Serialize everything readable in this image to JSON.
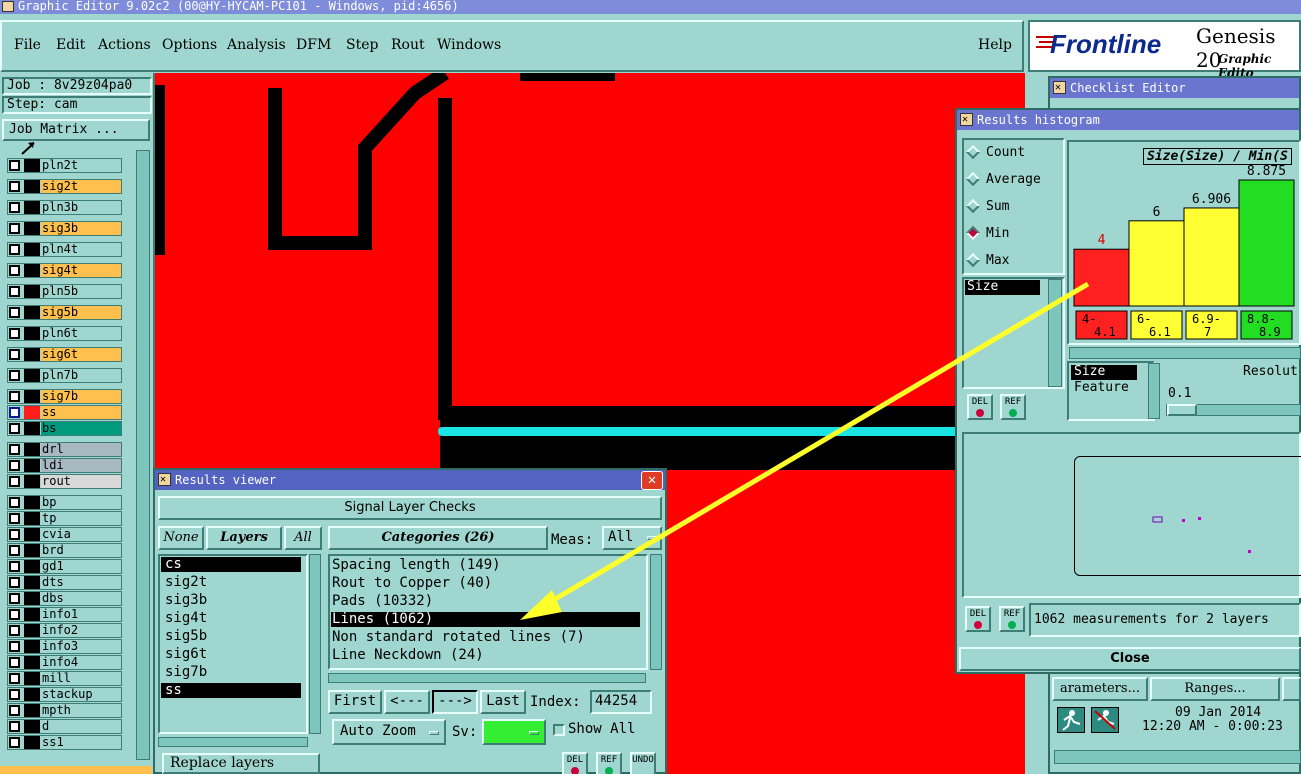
{
  "window": {
    "title": "Graphic Editor 9.02c2 (00@HY-HYCAM-PC101 - Windows, pid:4656)"
  },
  "menu": [
    "File",
    "Edit",
    "Actions",
    "Options",
    "Analysis",
    "DFM",
    "Step",
    "Rout",
    "Windows"
  ],
  "help": "Help",
  "brand": {
    "logo": "Frontline",
    "product": "Genesis 20",
    "subtitle": "Graphic Edito"
  },
  "job": {
    "job_label": "Job : 8v29z04pa0",
    "step_label": "Step: cam",
    "matrix_button": "Job Matrix ..."
  },
  "layers": [
    {
      "name": "pln2t",
      "color": "#9fd6cf"
    },
    {
      "name": "sig2t",
      "color": "#ffc04d"
    },
    {
      "name": "pln3b",
      "color": "#9fd6cf"
    },
    {
      "name": "sig3b",
      "color": "#ffc04d"
    },
    {
      "name": "pln4t",
      "color": "#9fd6cf"
    },
    {
      "name": "sig4t",
      "color": "#ffc04d"
    },
    {
      "name": "pln5b",
      "color": "#9fd6cf"
    },
    {
      "name": "sig5b",
      "color": "#ffc04d"
    },
    {
      "name": "pln6t",
      "color": "#9fd6cf"
    },
    {
      "name": "sig6t",
      "color": "#ffc04d"
    },
    {
      "name": "pln7b",
      "color": "#9fd6cf"
    },
    {
      "name": "sig7b",
      "color": "#ffc04d"
    },
    {
      "name": "ss",
      "color": "#ffc04d"
    },
    {
      "name": "bs",
      "color": "#009b7e"
    },
    {
      "name": "drl",
      "color": "#a8b8c0"
    },
    {
      "name": "ldi",
      "color": "#a8b8c0"
    },
    {
      "name": "rout",
      "color": "#d8d8d8"
    },
    {
      "name": "bp",
      "color": "#9fd6cf"
    },
    {
      "name": "tp",
      "color": "#9fd6cf"
    },
    {
      "name": "cvia",
      "color": "#9fd6cf"
    },
    {
      "name": "brd",
      "color": "#9fd6cf"
    },
    {
      "name": "gd1",
      "color": "#9fd6cf"
    },
    {
      "name": "dts",
      "color": "#9fd6cf"
    },
    {
      "name": "dbs",
      "color": "#9fd6cf"
    },
    {
      "name": "info1",
      "color": "#9fd6cf"
    },
    {
      "name": "info2",
      "color": "#9fd6cf"
    },
    {
      "name": "info3",
      "color": "#9fd6cf"
    },
    {
      "name": "info4",
      "color": "#9fd6cf"
    },
    {
      "name": "mill",
      "color": "#9fd6cf"
    },
    {
      "name": "stackup",
      "color": "#9fd6cf"
    },
    {
      "name": "mpth",
      "color": "#9fd6cf"
    },
    {
      "name": "d",
      "color": "#9fd6cf"
    },
    {
      "name": "ss1",
      "color": "#9fd6cf"
    }
  ],
  "results_viewer": {
    "title": "Results viewer",
    "header": "Signal Layer Checks",
    "none_btn": "None",
    "layers_btn": "Layers",
    "all_btn": "All",
    "categories_btn": "Categories (26)",
    "meas_label": "Meas:",
    "meas_value": "All",
    "layer_list": [
      "cs",
      "sig2t",
      "sig3b",
      "sig4t",
      "sig5b",
      "sig6t",
      "sig7b",
      "ss"
    ],
    "categories": [
      "Spacing length (149)",
      "Rout to Copper (40)",
      "Pads (10332)",
      "Lines (1062)",
      "Non standard rotated lines (7)",
      "Line Neckdown (24)"
    ],
    "first": "First",
    "prev": "<---",
    "next": "--->",
    "last": "Last",
    "index_label": "Index:",
    "index_value": "44254",
    "auto_zoom": "Auto Zoom",
    "sv_label": "Sv:",
    "show_all": "Show All",
    "replace_layers": "Replace layers",
    "del": "DEL",
    "ref": "REF",
    "undo": "UNDO"
  },
  "checklist": {
    "title": "Checklist Editor",
    "params_btn": "arameters...",
    "ranges_btn": "Ranges...",
    "date": "09 Jan 2014",
    "time": "12:20 AM - 0:00:23"
  },
  "histogram": {
    "title": "Results histogram",
    "radios": [
      "Count",
      "Average",
      "Sum",
      "Min",
      "Max"
    ],
    "selected": "Min",
    "chart_title": "Size(Size) / Min(S",
    "attribute_list": [
      "Size"
    ],
    "field_list": [
      "Size",
      "Feature"
    ],
    "resolution_label": "Resolut",
    "resolution_value": "0.1",
    "del": "DEL",
    "ref": "REF",
    "status": "1062 measurements for 2 layers",
    "close": "Close"
  },
  "chart_data": {
    "type": "bar",
    "categories": [
      "4-\n4.1",
      "6-\n6.1",
      "6.9-\n7",
      "8.8-\n8.9"
    ],
    "values": [
      4,
      6,
      6.906,
      8.875
    ],
    "value_labels": [
      "4",
      "6",
      "6.906",
      "8.875"
    ],
    "colors": [
      "#ff2020",
      "#ffff33",
      "#ffff33",
      "#22dd22"
    ],
    "title": "Size(Size) / Min(S",
    "ylim": [
      0,
      8.875
    ]
  }
}
